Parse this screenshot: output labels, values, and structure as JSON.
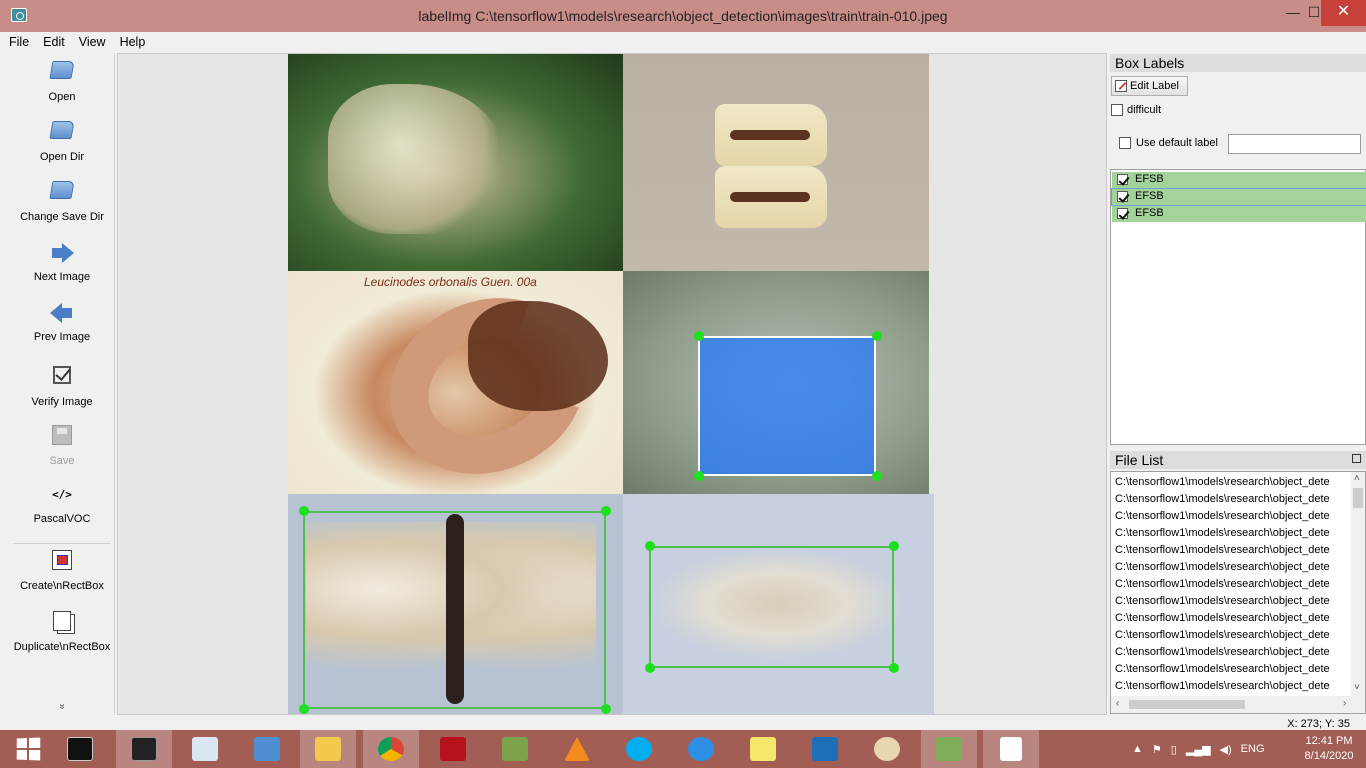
{
  "window": {
    "title": "labelImg C:\\tensorflow1\\models\\research\\object_detection\\images\\train\\train-010.jpeg",
    "min": "—",
    "max": "☐",
    "close": "✕"
  },
  "menu": [
    "File",
    "Edit",
    "View",
    "Help"
  ],
  "toolbar": {
    "open": "Open",
    "open_dir": "Open Dir",
    "change_save_dir": "Change Save Dir",
    "next_image": "Next Image",
    "prev_image": "Prev Image",
    "verify_image": "Verify Image",
    "save": "Save",
    "format_icon": "</>",
    "format": "PascalVOC",
    "create_rect": "Create\\nRectBox",
    "duplicate_rect": "Duplicate\\nRectBox",
    "more": "»"
  },
  "canvas": {
    "caption": "Leucinodes orbonalis Guen. 00a"
  },
  "box_labels": {
    "title": "Box Labels",
    "edit_label": "Edit Label",
    "difficult": "difficult",
    "use_default_label": "Use default label",
    "default_label_value": "",
    "items": [
      {
        "label": "EFSB",
        "checked": true
      },
      {
        "label": "EFSB",
        "checked": true
      },
      {
        "label": "EFSB",
        "checked": true
      }
    ]
  },
  "file_list": {
    "title": "File List",
    "items": [
      "C:\\tensorflow1\\models\\research\\object_dete",
      "C:\\tensorflow1\\models\\research\\object_dete",
      "C:\\tensorflow1\\models\\research\\object_dete",
      "C:\\tensorflow1\\models\\research\\object_dete",
      "C:\\tensorflow1\\models\\research\\object_dete",
      "C:\\tensorflow1\\models\\research\\object_dete",
      "C:\\tensorflow1\\models\\research\\object_dete",
      "C:\\tensorflow1\\models\\research\\object_dete",
      "C:\\tensorflow1\\models\\research\\object_dete",
      "C:\\tensorflow1\\models\\research\\object_dete",
      "C:\\tensorflow1\\models\\research\\object_dete",
      "C:\\tensorflow1\\models\\research\\object_dete",
      "C:\\tensorflow1\\models\\research\\object_dete"
    ]
  },
  "status": {
    "coords": "X: 273; Y: 35"
  },
  "taskbar": {
    "apps": [
      "cmd",
      "terminal",
      "performance-monitor",
      "remote-desktop",
      "file-explorer",
      "chrome",
      "autocad",
      "network-tool",
      "vlc",
      "skype",
      "sync",
      "sticky-notes",
      "virtualbox",
      "paint",
      "labelimg",
      "notepad"
    ],
    "language": "ENG",
    "time": "12:41 PM",
    "date": "8/14/2020"
  },
  "colors": {
    "titlebar": "#c98d87",
    "taskbar": "#a25d55",
    "label_row": "#a3d39a",
    "box_stroke": "#4fbf4f",
    "vertex": "#1ee01e",
    "selected_fill": "#1e78ff"
  }
}
